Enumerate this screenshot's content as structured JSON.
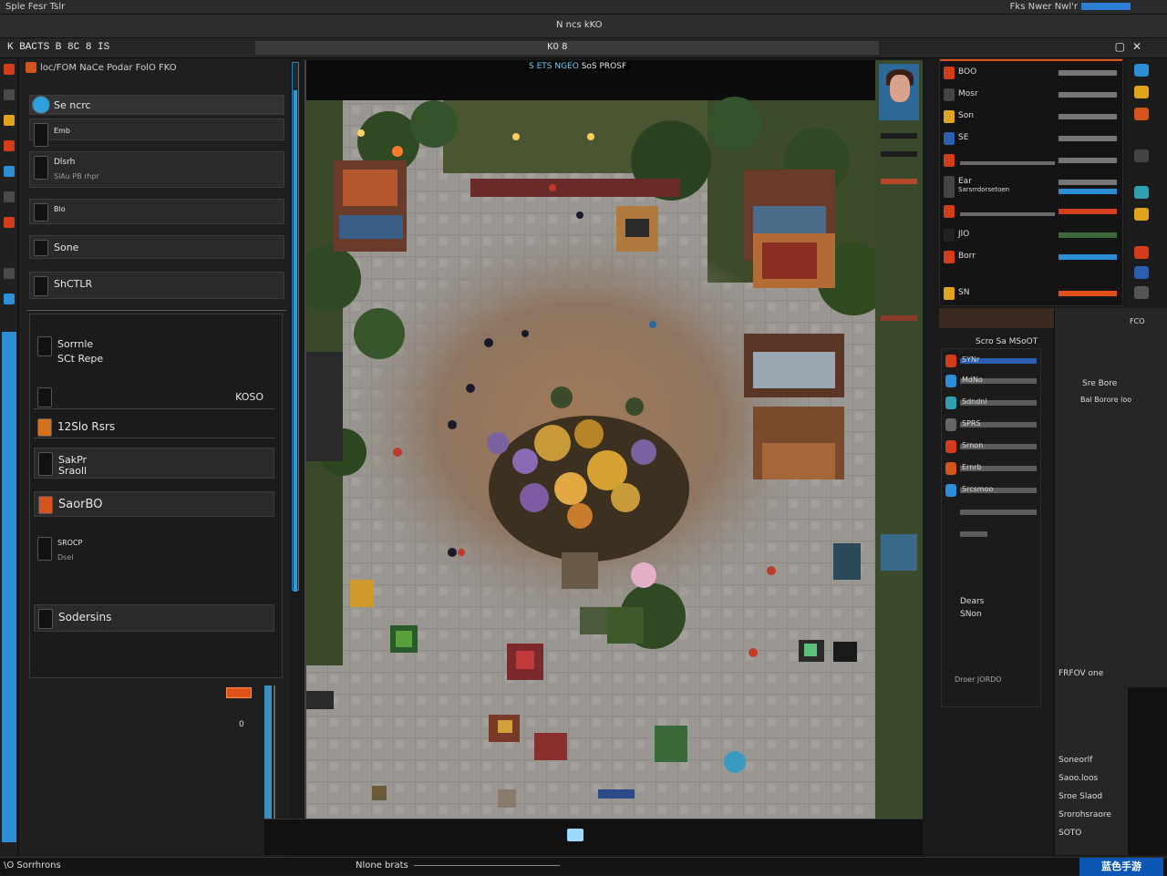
{
  "titlebar": {
    "left": "Sple Fesr  Tslr",
    "right": "Fks   Nwer Nwl'r"
  },
  "toolbar": {
    "center": "N  ncs  kKO"
  },
  "docbar": {
    "document": "K  BACTS  B  8C  8  IS",
    "tab": "K0   8"
  },
  "layer_panel": {
    "header": "loc/FOM  NaCe Podar  FolO  FKO",
    "rows": [
      {
        "label": "Se ncrc",
        "sub": ""
      },
      {
        "label": "Emb",
        "sub": ""
      },
      {
        "label": "Dlsrh",
        "sub": "SlAu PB rhpr"
      },
      {
        "label": "Blo",
        "sub": ""
      },
      {
        "label": "Sone",
        "sub": ""
      },
      {
        "label": "ShCTLR",
        "sub": ""
      }
    ]
  },
  "props_box": {
    "items": [
      {
        "label": "Sorrnle",
        "sub": "SCt Repe"
      },
      {
        "label": "",
        "value": "KOSO"
      },
      {
        "label": "12Slo  Rsrs",
        "value": ""
      },
      {
        "label": "SakPr",
        "sub": "Sraoll"
      },
      {
        "label": "SaorBO",
        "value": ""
      },
      {
        "label": "SROCP",
        "sub": "Dsel"
      },
      {
        "label": "Sodersins",
        "value": ""
      }
    ]
  },
  "slider_readout": "0",
  "canvas": {
    "title_highlight": "S ETS NGEO",
    "title": "SoS PROSF"
  },
  "asset_panel": {
    "rows": [
      {
        "text": "BOO"
      },
      {
        "text": "Mosr"
      },
      {
        "text": "Son"
      },
      {
        "text": "SE"
      },
      {
        "text": ""
      },
      {
        "text": "Ear"
      },
      {
        "text": "Sarsrrdorsetoen"
      },
      {
        "text": ""
      },
      {
        "text": "JlO"
      },
      {
        "text": "Borr"
      },
      {
        "text": "SN"
      }
    ]
  },
  "mid_panel": {
    "title": "Scro Sa MSoOT"
  },
  "list_panel": {
    "rows": [
      "SYNr",
      "MdNo",
      "Sdndnl",
      "SPRS",
      "Srnon",
      "Ernrb",
      "Srcsmoo",
      "",
      ""
    ],
    "foot1": "Dears",
    "foot2": "SNon",
    "foot3": "Droer JORDO"
  },
  "right_col": {
    "header": "FCO",
    "t1": "Sre  Bore",
    "t2": "Bal Borore loo",
    "t3": "FRFOV  one",
    "t4": [
      "Soneorlf",
      "Saoo.loos",
      "Sroe Slaod",
      "Srorohsraore",
      "SOTO"
    ]
  },
  "statusbar": {
    "left": "\\O  Sorrhrons",
    "mid": "Nlone brats",
    "logo": "蓝色手游"
  },
  "colors": {
    "accent_orange": "#e0521a",
    "accent_blue": "#2d7fd6",
    "panel_bg": "#1f1f1f"
  }
}
